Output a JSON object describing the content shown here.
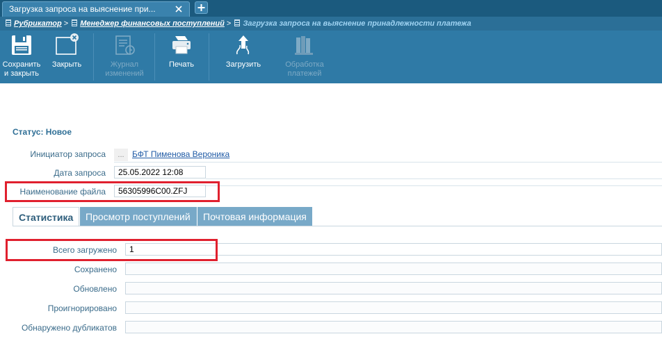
{
  "tabstrip": {
    "tab_title": "Загрузка запроса на выяснение при...",
    "close_icon": "close-icon",
    "add_icon": "plus-icon"
  },
  "breadcrumb": {
    "item1": "Рубрикатор",
    "item2": "Менеджер финансовых поступлений",
    "current": "Загрузка запроса на выяснение принадлежности платежа",
    "separator": ">"
  },
  "toolbar": {
    "save_close": {
      "line1": "Сохранить",
      "line2": "и закрыть",
      "icon": "save-icon"
    },
    "close": {
      "line1": "Закрыть",
      "icon": "close-window-icon"
    },
    "journal": {
      "line1": "Журнал",
      "line2": "изменений",
      "icon": "journal-icon"
    },
    "print": {
      "line1": "Печать",
      "icon": "printer-icon"
    },
    "upload": {
      "line1": "Загрузить",
      "icon": "upload-icon"
    },
    "process": {
      "line1": "Обработка",
      "line2": "платежей",
      "icon": "books-icon"
    }
  },
  "form": {
    "status": "Статус: Новое",
    "initiator_label": "Инициатор запроса",
    "initiator_dots": "...",
    "initiator_value": "БФТ Пименова Вероника",
    "date_label": "Дата запроса",
    "date_value": "25.05.2022 12:08",
    "filename_label": "Наименование файла",
    "filename_value": "56305996C00.ZFJ"
  },
  "inner_tabs": [
    {
      "label": "Статистика",
      "active": true
    },
    {
      "label": "Просмотр поступлений",
      "active": false
    },
    {
      "label": "Почтовая информация",
      "active": false
    }
  ],
  "stats": {
    "total_label": "Всего загружено",
    "total_value": "1",
    "saved_label": "Сохранено",
    "saved_value": "",
    "updated_label": "Обновлено",
    "updated_value": "",
    "ignored_label": "Проигнорировано",
    "ignored_value": "",
    "duplicates_label": "Обнаружено дубликатов",
    "duplicates_value": ""
  },
  "colors": {
    "toolbar": "#2f7aa6",
    "highlight": "#e0202e",
    "link": "#1f5aa5"
  }
}
